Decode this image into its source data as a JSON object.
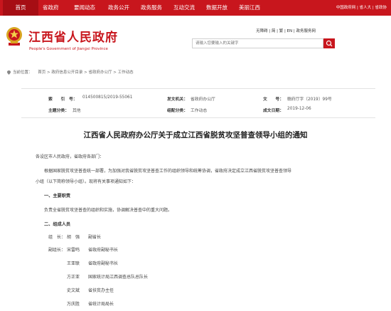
{
  "topnav": {
    "items": [
      "首页",
      "省政府",
      "要闻动态",
      "政务公开",
      "政务服务",
      "互动交流",
      "数据开放",
      "美丽江西"
    ],
    "right_links": "中国政府网 | 省人大 | 省政协"
  },
  "header": {
    "title": "江西省人民政府",
    "subtitle": "People's Government of Jiangxi Province",
    "util_links": "无障碍 | 简 | 繁 | EN | 政务服务网",
    "search_placeholder": "请输入您要输入的关键字"
  },
  "breadcrumb": {
    "prefix": "当前位置：",
    "trail": "首页 > 政府信息公开目录 > 省政府办公厅 > 工作动态"
  },
  "meta": {
    "index_label": "索　　引　号：",
    "index_value": "014500815/2019-55061",
    "issuer_label": "发文机关：",
    "issuer_value": "省政府办公厅",
    "docno_label": "文　　号：",
    "docno_value": "赣府厅字〔2019〕99号",
    "category_label": "主题分类：",
    "category_value": "其他",
    "org_label": "组配分类：",
    "org_value": "工作动态",
    "date_label": "成文日期：",
    "date_value": "2019-12-06"
  },
  "document": {
    "title": "江西省人民政府办公厅关于成立江西省脱贫攻坚普查领导小组的通知",
    "salutation": "各设区市人民政府，省政府各部门：",
    "intro_line1": "根据国家脱贫攻坚普查统一部署，为加强对我省脱贫攻坚普查工作的组织领导和统筹协调，省政府决定成立江西省脱贫攻坚普查领导",
    "intro_line2": "小组（以下简称领导小组）。现将有关事项通知如下：",
    "section1_title": "一、主要职责",
    "section1_text": "负责全省脱贫攻坚普查的组织和实施，协调解决普查中的重大问题。",
    "section2_title": "二、组成人员",
    "members": [
      {
        "role": "组　长：",
        "name": "胡　强",
        "title": "副省长"
      },
      {
        "role": "副组长：",
        "name": "宋雷鸣",
        "title": "省政府副秘书长"
      },
      {
        "role": "",
        "name": "王亚联",
        "title": "省政府副秘书长"
      },
      {
        "role": "",
        "name": "方正亚",
        "title": "国家统计局江西调查总队总队长"
      },
      {
        "role": "",
        "name": "史文斌",
        "title": "省扶贫办主任"
      },
      {
        "role": "",
        "name": "万庆胜",
        "title": "省统计局局长"
      }
    ]
  },
  "colors": {
    "brand_red": "#c8161d",
    "nav_active": "#a60e14"
  }
}
